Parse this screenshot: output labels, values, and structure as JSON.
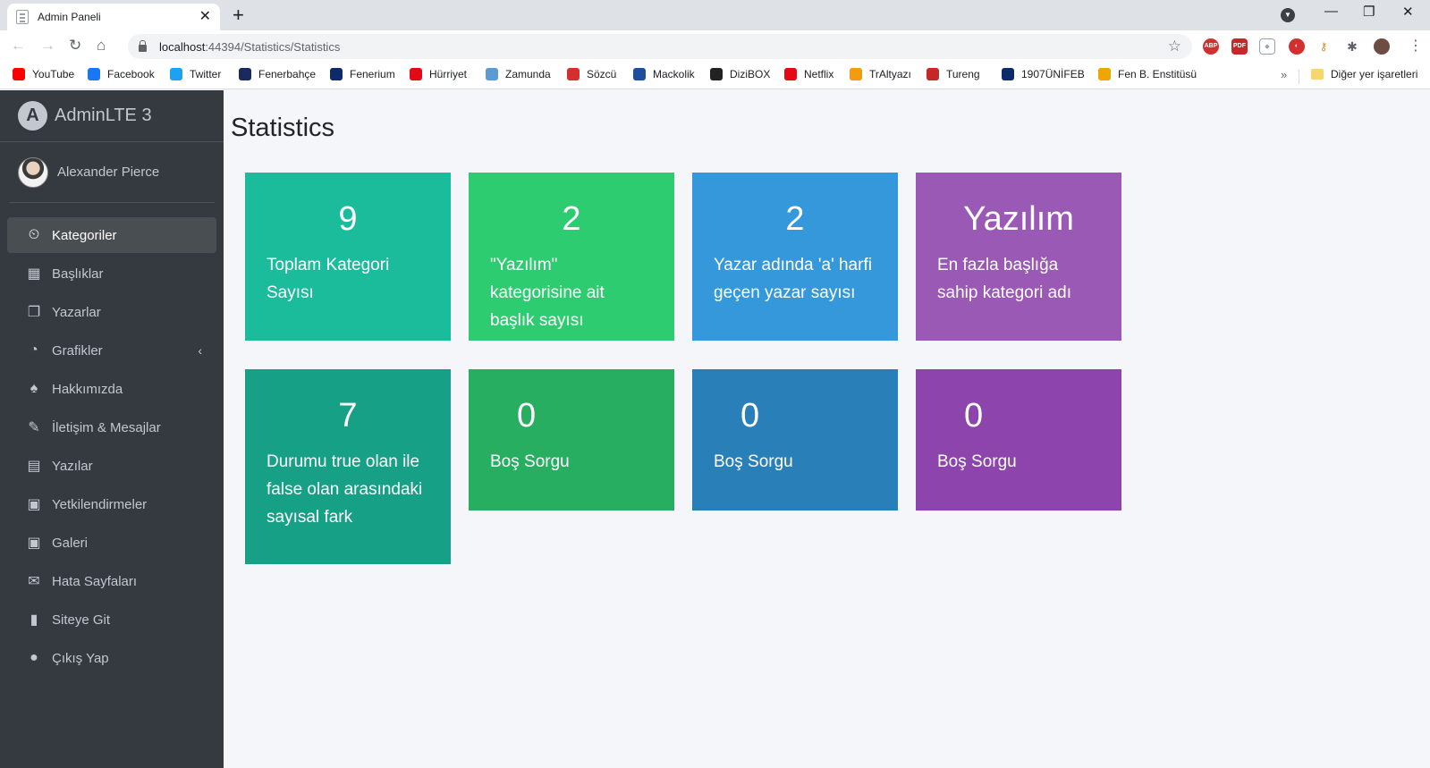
{
  "browser": {
    "tab_title": "Admin Paneli",
    "url_host": "localhost",
    "url_path": ":44394/Statistics/Statistics",
    "bookmarks": [
      {
        "label": "YouTube",
        "color": "#ff0000",
        "icon": "youtube-icon"
      },
      {
        "label": "Facebook",
        "color": "#1877f2",
        "icon": "facebook-icon"
      },
      {
        "label": "Twitter",
        "color": "#1da1f2",
        "icon": "twitter-icon"
      },
      {
        "label": "Fenerbahçe",
        "color": "#1b2a5e",
        "icon": "fenerbahce-icon"
      },
      {
        "label": "Fenerium",
        "color": "#0d2b6b",
        "icon": "fenerium-icon"
      },
      {
        "label": "Hürriyet",
        "color": "#e30a17",
        "icon": "hurriyet-icon"
      },
      {
        "label": "Zamunda",
        "color": "#5b9bd5",
        "icon": "zamunda-icon"
      },
      {
        "label": "Sözcü",
        "color": "#d32f2f",
        "icon": "sozcu-icon"
      },
      {
        "label": "Mackolik",
        "color": "#1f4e9c",
        "icon": "mackolik-icon"
      },
      {
        "label": "DiziBOX",
        "color": "#222222",
        "icon": "dizibox-icon"
      },
      {
        "label": "Netflix",
        "color": "#e50914",
        "icon": "netflix-icon"
      },
      {
        "label": "TrAltyazı",
        "color": "#f39c12",
        "icon": "traltyazi-icon"
      },
      {
        "label": "Tureng",
        "color": "#c62828",
        "icon": "tureng-icon"
      },
      {
        "label": "1907ÜNİFEB",
        "color": "#0d2b6b",
        "icon": "unifeb-icon"
      },
      {
        "label": "Fen B. Enstitüsü",
        "color": "#f0a500",
        "icon": "fbe-icon"
      }
    ],
    "other_bookmarks": "Diğer yer işaretleri"
  },
  "sidebar": {
    "brand": "AdminLTE 3",
    "brand_logo": "A",
    "user_name": "Alexander Pierce",
    "items": [
      {
        "label": "Kategoriler",
        "icon": "⏲",
        "icon_name": "tachometer-icon",
        "active": true
      },
      {
        "label": "Başlıklar",
        "icon": "▦",
        "icon_name": "grid-icon",
        "active": false
      },
      {
        "label": "Yazarlar",
        "icon": "❐",
        "icon_name": "copy-icon",
        "active": false
      },
      {
        "label": "Grafikler",
        "icon": "◔",
        "icon_name": "pie-chart-icon",
        "active": false,
        "arrow": "‹"
      },
      {
        "label": "Hakkımızda",
        "icon": "♠",
        "icon_name": "tree-icon",
        "active": false
      },
      {
        "label": "İletişim & Mesajlar",
        "icon": "✎",
        "icon_name": "edit-icon",
        "active": false
      },
      {
        "label": "Yazılar",
        "icon": "▤",
        "icon_name": "table-icon",
        "active": false
      },
      {
        "label": "Yetkilendirmeler",
        "icon": "▣",
        "icon_name": "image-icon",
        "active": false
      },
      {
        "label": "Galeri",
        "icon": "▣",
        "icon_name": "gallery-icon",
        "active": false
      },
      {
        "label": "Hata Sayfaları",
        "icon": "✉",
        "icon_name": "envelope-icon",
        "active": false
      },
      {
        "label": "Siteye Git",
        "icon": "▮",
        "icon_name": "book-icon",
        "active": false
      },
      {
        "label": "Çıkış Yap",
        "icon": "●",
        "icon_name": "apple-icon",
        "active": false
      }
    ]
  },
  "main": {
    "title": "Statistics",
    "boxes": [
      {
        "value": "9",
        "label": "Toplam Kategori Sayısı",
        "color": "#1abc9c"
      },
      {
        "value": "2",
        "label": "\"Yazılım\" kategorisine ait başlık sayısı",
        "color": "#2ecc71"
      },
      {
        "value": "2",
        "label": "Yazar adında 'a' harfi geçen yazar sayısı",
        "color": "#3498db"
      },
      {
        "value": "Yazılım",
        "label": "En fazla başlığa sahip kategori adı",
        "color": "#9b59b6"
      },
      {
        "value": "7",
        "label": "Durumu true olan ile false olan arasındaki sayısal fark",
        "color": "#16a085"
      },
      {
        "value": "0",
        "label": "Boş Sorgu",
        "color": "#27ae60"
      },
      {
        "value": "0",
        "label": "Boş Sorgu",
        "color": "#2980b9"
      },
      {
        "value": "0",
        "label": "Boş Sorgu",
        "color": "#8e44ad"
      }
    ]
  }
}
